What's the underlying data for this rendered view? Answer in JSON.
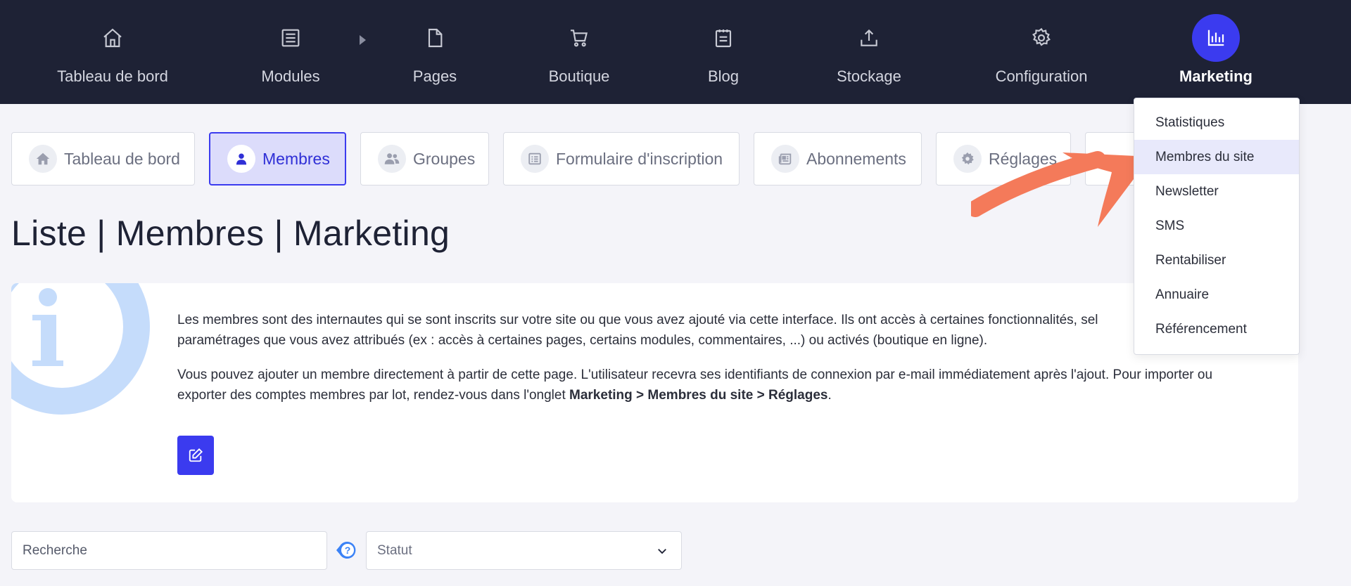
{
  "nav": {
    "items": [
      {
        "label": "Tableau de bord",
        "icon": "home-icon"
      },
      {
        "label": "Modules",
        "icon": "list-icon"
      },
      {
        "label": "Pages",
        "icon": "page-icon"
      },
      {
        "label": "Boutique",
        "icon": "cart-icon"
      },
      {
        "label": "Blog",
        "icon": "notepad-icon"
      },
      {
        "label": "Stockage",
        "icon": "upload-icon"
      },
      {
        "label": "Configuration",
        "icon": "gear-icon"
      },
      {
        "label": "Marketing",
        "icon": "bar-chart-icon",
        "active": true
      }
    ]
  },
  "tabs": [
    {
      "label": "Tableau de bord",
      "icon": "home-icon"
    },
    {
      "label": "Membres",
      "icon": "user-icon",
      "active": true
    },
    {
      "label": "Groupes",
      "icon": "users-icon"
    },
    {
      "label": "Formulaire d'inscription",
      "icon": "form-icon"
    },
    {
      "label": "Abonnements",
      "icon": "newspaper-icon"
    },
    {
      "label": "Réglages",
      "icon": "gear-icon"
    }
  ],
  "page_title": "Liste | Membres | Marketing",
  "info": {
    "p1": "Les membres sont des internautes qui se sont inscrits sur votre site ou que vous avez ajouté via cette interface. Ils ont accès à certaines fonctionnalités, sel",
    "p1b": "paramétrages que vous avez attribués (ex : accès à certaines pages, certains modules, commentaires, ...) ou activés (boutique en ligne).",
    "p2": "Vous pouvez ajouter un membre directement à partir de cette page. L'utilisateur recevra ses identifiants de connexion par e-mail immédiatement après l'ajout. Pour importer ou exporter des comptes membres par lot, rendez-vous dans l'onglet",
    "p2_bold": "Marketing > Membres du site > Réglages",
    "p2_end": "."
  },
  "filters": {
    "search_placeholder": "Recherche",
    "status_label": "Statut"
  },
  "dropdown": {
    "items": [
      "Statistiques",
      "Membres du site",
      "Newsletter",
      "SMS",
      "Rentabiliser",
      "Annuaire",
      "Référencement"
    ],
    "active_index": 1
  },
  "colors": {
    "nav_bg": "#1e2235",
    "accent": "#3b3bef",
    "arrow": "#f47a5a"
  }
}
